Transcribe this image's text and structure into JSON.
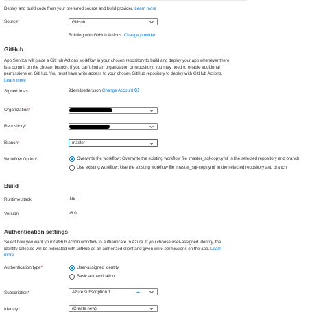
{
  "intro": {
    "text": "Deploy and build code from your preferred source and build provider.",
    "link": "Learn more"
  },
  "source": {
    "label": "Source",
    "value": "GitHub",
    "note": "Building with GitHub Actions.",
    "change_link": "Change provider."
  },
  "github": {
    "heading": "GitHub",
    "desc_line1": "App Service will place a GitHub Actions workflow in your chosen repository to build and deploy your app whenever there",
    "desc_line2": "is a commit on the chosen branch. If you can't find an organization or repository, you may need to enable additional",
    "desc_line3": "permissions on GitHub. You must have write access to your chosen GitHub repository to deploy with GitHub Actions.",
    "desc_link": "Learn more",
    "signed_in_label": "Signed in as",
    "signed_in_value": "91emilpettersson",
    "change_account": "Change Account",
    "organization_label": "Organization",
    "repository_label": "Repository",
    "branch_label": "Branch",
    "branch_value": "master",
    "workflow_label": "Workflow Option",
    "workflow_opt1": "Overwrite the workflow: Overwrite the existing workflow file 'master_sql-copy.yml' in the selected repository and branch.",
    "workflow_opt2": "Use existing workflow: Use the existing workflow file 'master_sql-copy.yml' in the selected repository and branch."
  },
  "build": {
    "heading": "Build",
    "runtime_label": "Runtime stack",
    "runtime_value": ".NET",
    "version_label": "Version",
    "version_value": "v8.0"
  },
  "auth": {
    "heading": "Authentication settings",
    "desc_line1": "Select how you want your GitHub Action workflow to authenticate to Azure. If you choose user-assigned identity, the",
    "desc_line2": "identity selected will be federated with GitHub as an authorized client and given write permissions on the app.",
    "desc_link_a": "Learn",
    "desc_link_b": "more",
    "type_label": "Authentication type",
    "type_opt1": "User-assigned identity",
    "type_opt2": "Basic authentication",
    "subscription_label": "Subscription",
    "subscription_value": "Azure subscription 1",
    "identity_label": "Identity",
    "identity_value": "(Create new)"
  },
  "colors": {
    "accent": "#0078d4",
    "required": "#a4262c",
    "text": "#323130"
  }
}
